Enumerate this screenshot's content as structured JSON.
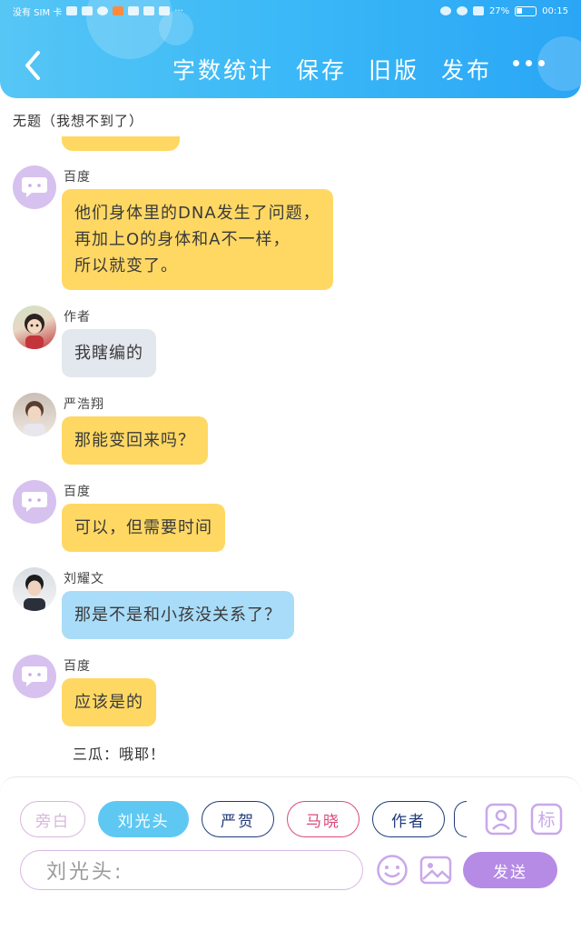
{
  "status_bar": {
    "left_text": "没有 SIM 卡",
    "battery": "27%",
    "time": "00:15"
  },
  "header": {
    "back_icon": "chevron-left-icon",
    "actions": [
      "字数统计",
      "保存",
      "旧版",
      "发布"
    ],
    "more_icon": "more-dots-icon"
  },
  "chat": {
    "title": "无题（我想不到了）",
    "messages": [
      {
        "sender": "百度",
        "avatar": "baidu-chat-icon",
        "bubble": "yellow",
        "lines": [
          "他们身体里的DNA发生了问题，",
          "再加上O的身体和A不一样，",
          "所以就变了。"
        ]
      },
      {
        "sender": "作者",
        "avatar": "author-avatar",
        "bubble": "grey",
        "lines": [
          "我瞎编的"
        ]
      },
      {
        "sender": "严浩翔",
        "avatar": "yanhaoxiang-avatar",
        "bubble": "yellow",
        "lines": [
          "那能变回来吗？"
        ]
      },
      {
        "sender": "百度",
        "avatar": "baidu-chat-icon",
        "bubble": "yellow",
        "lines": [
          "可以，但需要时间"
        ]
      },
      {
        "sender": "刘耀文",
        "avatar": "liuyaowen-avatar",
        "bubble": "blue",
        "lines": [
          "那是不是和小孩没关系了？"
        ]
      },
      {
        "sender": "百度",
        "avatar": "baidu-chat-icon",
        "bubble": "yellow",
        "lines": [
          "应该是的"
        ]
      }
    ],
    "aside": "三瓜：哦耶！"
  },
  "composer": {
    "characters": [
      "旁白",
      "刘光头",
      "严贺",
      "马晓",
      "作者"
    ],
    "selected_character": "刘光头",
    "input_placeholder": "刘光头:",
    "send_label": "发送",
    "tools": {
      "profile_icon": "profile-card-icon",
      "tag_label": "标",
      "emoji_icon": "smiley-icon",
      "image_icon": "image-icon"
    }
  },
  "colors": {
    "header": "#3ab8f7",
    "bubble_yellow": "#ffd864",
    "bubble_grey": "#e3e7ee",
    "bubble_blue": "#a9dcf8",
    "accent_purple": "#b58be6",
    "chip_selected": "#5ec8f3"
  }
}
